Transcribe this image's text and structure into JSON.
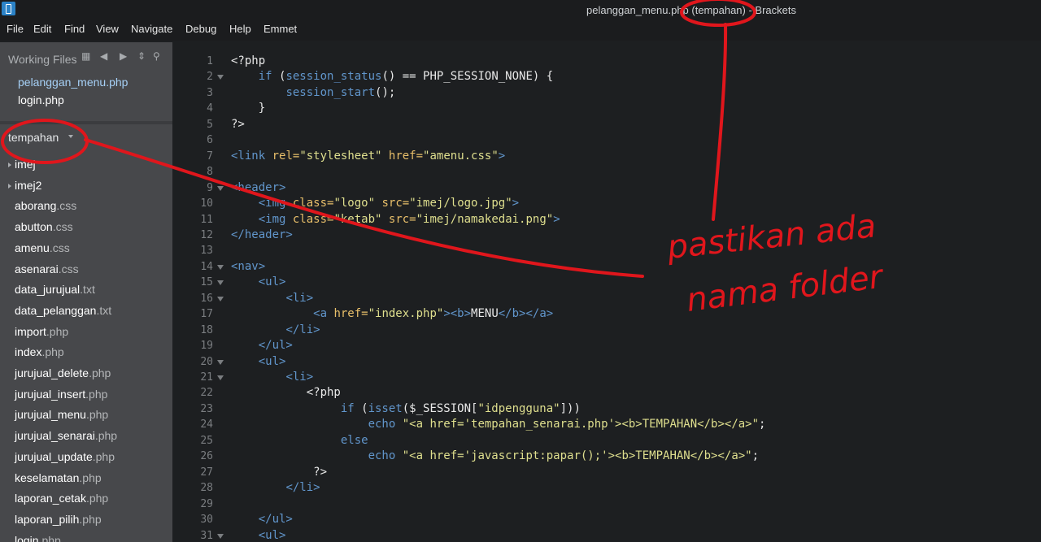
{
  "window": {
    "title": "pelanggan_menu.php (tempahan) - Brackets"
  },
  "menubar": {
    "items": [
      "File",
      "Edit",
      "Find",
      "View",
      "Navigate",
      "Debug",
      "Help",
      "Emmet"
    ]
  },
  "sidebar": {
    "working_files_label": "Working Files",
    "working_files": [
      {
        "name": "pelanggan_menu.php",
        "active": true
      },
      {
        "name": "login.php",
        "active": false
      }
    ],
    "project_name": "tempahan",
    "tree": [
      {
        "name": "imej",
        "ext": "",
        "folder": true
      },
      {
        "name": "imej2",
        "ext": "",
        "folder": true
      },
      {
        "name": "aborang",
        "ext": ".css"
      },
      {
        "name": "abutton",
        "ext": ".css"
      },
      {
        "name": "amenu",
        "ext": ".css"
      },
      {
        "name": "asenarai",
        "ext": ".css"
      },
      {
        "name": "data_jurujual",
        "ext": ".txt"
      },
      {
        "name": "data_pelanggan",
        "ext": ".txt"
      },
      {
        "name": "import",
        "ext": ".php"
      },
      {
        "name": "index",
        "ext": ".php"
      },
      {
        "name": "jurujual_delete",
        "ext": ".php"
      },
      {
        "name": "jurujual_insert",
        "ext": ".php"
      },
      {
        "name": "jurujual_menu",
        "ext": ".php"
      },
      {
        "name": "jurujual_senarai",
        "ext": ".php"
      },
      {
        "name": "jurujual_update",
        "ext": ".php"
      },
      {
        "name": "keselamatan",
        "ext": ".php"
      },
      {
        "name": "laporan_cetak",
        "ext": ".php"
      },
      {
        "name": "laporan_pilih",
        "ext": ".php"
      },
      {
        "name": "login",
        "ext": ".php"
      }
    ]
  },
  "colors": {
    "keyword": "#6196cc",
    "tag": "#6196cc",
    "attr": "#e8bf6a",
    "string": "#dfdf8e",
    "text": "#e8e8e8",
    "php_tag": "#e8e8e8",
    "annotation": "#e0161c"
  },
  "editor": {
    "lines": [
      {
        "n": 1,
        "fold": false,
        "tokens": [
          [
            "<?php",
            "php_tag"
          ]
        ]
      },
      {
        "n": 2,
        "fold": true,
        "tokens": [
          [
            "    ",
            "text"
          ],
          [
            "if",
            "keyword"
          ],
          [
            " (",
            "text"
          ],
          [
            "session_status",
            "keyword"
          ],
          [
            "() == PHP_SESSION_NONE) {",
            "text"
          ]
        ]
      },
      {
        "n": 3,
        "fold": false,
        "tokens": [
          [
            "        ",
            "text"
          ],
          [
            "session_start",
            "keyword"
          ],
          [
            "();",
            "text"
          ]
        ]
      },
      {
        "n": 4,
        "fold": false,
        "tokens": [
          [
            "    }",
            "text"
          ]
        ]
      },
      {
        "n": 5,
        "fold": false,
        "tokens": [
          [
            "?>",
            "php_tag"
          ]
        ]
      },
      {
        "n": 6,
        "fold": false,
        "tokens": []
      },
      {
        "n": 7,
        "fold": false,
        "tokens": [
          [
            "<link",
            "tag"
          ],
          [
            " rel=",
            "attr"
          ],
          [
            "\"stylesheet\"",
            "string"
          ],
          [
            " href=",
            "attr"
          ],
          [
            "\"amenu.css\"",
            "string"
          ],
          [
            ">",
            "tag"
          ]
        ]
      },
      {
        "n": 8,
        "fold": false,
        "tokens": []
      },
      {
        "n": 9,
        "fold": true,
        "tokens": [
          [
            "<header>",
            "tag"
          ]
        ]
      },
      {
        "n": 10,
        "fold": false,
        "tokens": [
          [
            "    ",
            "text"
          ],
          [
            "<img",
            "tag"
          ],
          [
            " class=",
            "attr"
          ],
          [
            "\"logo\"",
            "string"
          ],
          [
            " src=",
            "attr"
          ],
          [
            "\"imej/logo.jpg\"",
            "string"
          ],
          [
            ">",
            "tag"
          ]
        ]
      },
      {
        "n": 11,
        "fold": false,
        "tokens": [
          [
            "    ",
            "text"
          ],
          [
            "<img",
            "tag"
          ],
          [
            " class=",
            "attr"
          ],
          [
            "\"ketab\"",
            "string"
          ],
          [
            " src=",
            "attr"
          ],
          [
            "\"imej/namakedai.png\"",
            "string"
          ],
          [
            ">",
            "tag"
          ]
        ]
      },
      {
        "n": 12,
        "fold": false,
        "tokens": [
          [
            "</header>",
            "tag"
          ]
        ]
      },
      {
        "n": 13,
        "fold": false,
        "tokens": []
      },
      {
        "n": 14,
        "fold": true,
        "tokens": [
          [
            "<nav>",
            "tag"
          ]
        ]
      },
      {
        "n": 15,
        "fold": true,
        "tokens": [
          [
            "    ",
            "text"
          ],
          [
            "<ul>",
            "tag"
          ]
        ]
      },
      {
        "n": 16,
        "fold": true,
        "tokens": [
          [
            "        ",
            "text"
          ],
          [
            "<li>",
            "tag"
          ]
        ]
      },
      {
        "n": 17,
        "fold": false,
        "tokens": [
          [
            "            ",
            "text"
          ],
          [
            "<a",
            "tag"
          ],
          [
            " href=",
            "attr"
          ],
          [
            "\"index.php\"",
            "string"
          ],
          [
            "><b>",
            "tag"
          ],
          [
            "MENU",
            "text"
          ],
          [
            "</b></a>",
            "tag"
          ]
        ]
      },
      {
        "n": 18,
        "fold": false,
        "tokens": [
          [
            "        ",
            "text"
          ],
          [
            "</li>",
            "tag"
          ]
        ]
      },
      {
        "n": 19,
        "fold": false,
        "tokens": [
          [
            "    ",
            "text"
          ],
          [
            "</ul>",
            "tag"
          ]
        ]
      },
      {
        "n": 20,
        "fold": true,
        "tokens": [
          [
            "    ",
            "text"
          ],
          [
            "<ul>",
            "tag"
          ]
        ]
      },
      {
        "n": 21,
        "fold": true,
        "tokens": [
          [
            "        ",
            "text"
          ],
          [
            "<li>",
            "tag"
          ]
        ]
      },
      {
        "n": 22,
        "fold": false,
        "tokens": [
          [
            "           <?php",
            "php_tag"
          ]
        ]
      },
      {
        "n": 23,
        "fold": false,
        "tokens": [
          [
            "                ",
            "text"
          ],
          [
            "if",
            "keyword"
          ],
          [
            " (",
            "text"
          ],
          [
            "isset",
            "keyword"
          ],
          [
            "($_SESSION[",
            "text"
          ],
          [
            "\"idpengguna\"",
            "string"
          ],
          [
            "]))",
            "text"
          ]
        ]
      },
      {
        "n": 24,
        "fold": false,
        "tokens": [
          [
            "                    ",
            "text"
          ],
          [
            "echo",
            "keyword"
          ],
          [
            " ",
            "text"
          ],
          [
            "\"<a href='tempahan_senarai.php'><b>TEMPAHAN</b></a>\"",
            "string"
          ],
          [
            ";",
            "text"
          ]
        ]
      },
      {
        "n": 25,
        "fold": false,
        "tokens": [
          [
            "                ",
            "text"
          ],
          [
            "else",
            "keyword"
          ]
        ]
      },
      {
        "n": 26,
        "fold": false,
        "tokens": [
          [
            "                    ",
            "text"
          ],
          [
            "echo",
            "keyword"
          ],
          [
            " ",
            "text"
          ],
          [
            "\"<a href='javascript:papar();'><b>TEMPAHAN</b></a>\"",
            "string"
          ],
          [
            ";",
            "text"
          ]
        ]
      },
      {
        "n": 27,
        "fold": false,
        "tokens": [
          [
            "            ?>",
            "php_tag"
          ]
        ]
      },
      {
        "n": 28,
        "fold": false,
        "tokens": [
          [
            "        ",
            "text"
          ],
          [
            "</li>",
            "tag"
          ]
        ]
      },
      {
        "n": 29,
        "fold": false,
        "tokens": []
      },
      {
        "n": 30,
        "fold": false,
        "tokens": [
          [
            "    ",
            "text"
          ],
          [
            "</ul>",
            "tag"
          ]
        ]
      },
      {
        "n": 31,
        "fold": true,
        "tokens": [
          [
            "    ",
            "text"
          ],
          [
            "<ul>",
            "tag"
          ]
        ]
      }
    ]
  },
  "annotation": {
    "line1": "pastikan ada",
    "line2": "nama folder"
  }
}
